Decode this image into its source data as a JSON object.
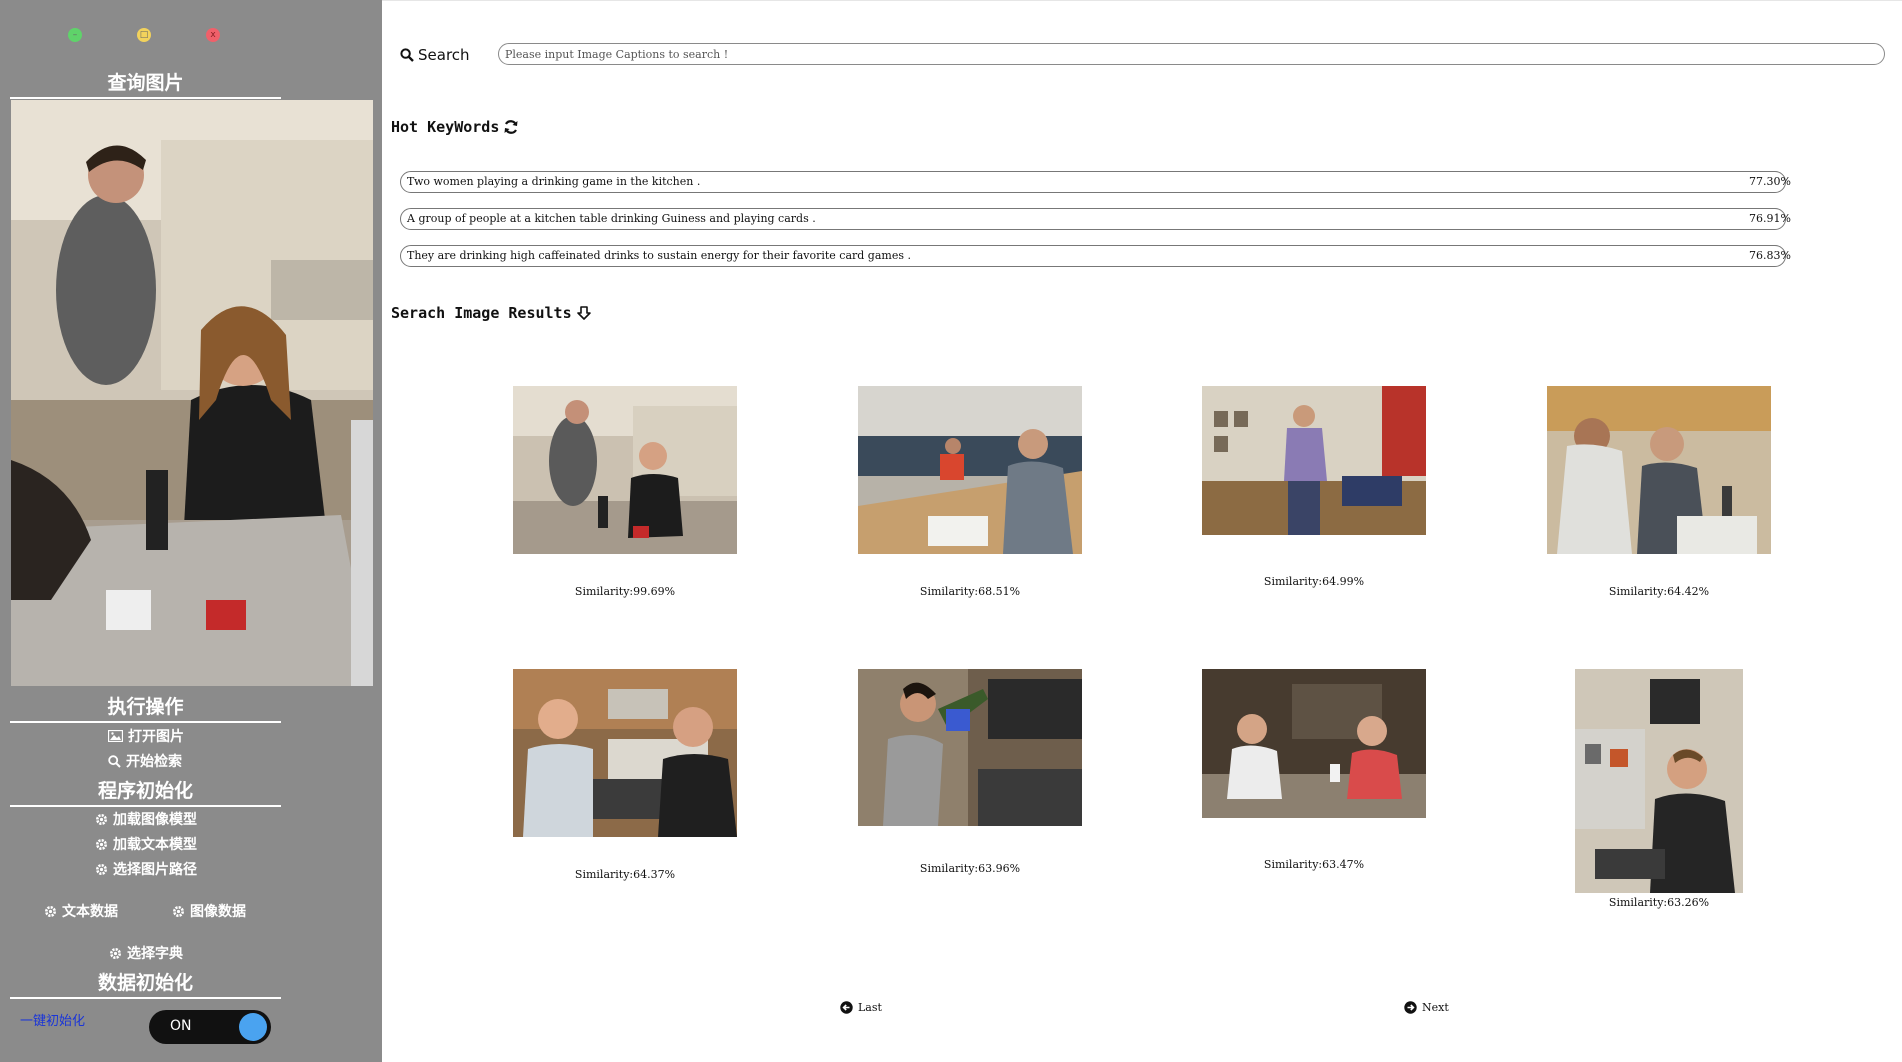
{
  "window_controls": {
    "minimize": "–",
    "maximize": "□",
    "close": "x"
  },
  "sidebar": {
    "query_title": "查询图片",
    "ops_title": "执行操作",
    "open_image": "打开图片",
    "start_search": "开始检索",
    "init_title": "程序初始化",
    "load_image_model": "加载图像模型",
    "load_text_model": "加载文本模型",
    "select_image_path": "选择图片路径",
    "text_data": "文本数据",
    "image_data": "图像数据",
    "select_dictionary": "选择字典",
    "data_init_title": "数据初始化",
    "one_key_init": "一键初始化",
    "toggle_label": "ON",
    "toggle_state": "on"
  },
  "search": {
    "label": "Search",
    "placeholder": "Please input Image Captions to search !",
    "value": ""
  },
  "hot_keywords": {
    "title": "Hot KeyWords",
    "items": [
      {
        "text": "Two women playing a drinking game in the kitchen .",
        "score": "77.30%"
      },
      {
        "text": "A group of people at a kitchen table drinking Guiness and playing cards .",
        "score": "76.91%"
      },
      {
        "text": "They are drinking high caffeinated drinks to sustain energy for their favorite card games .",
        "score": "76.83%"
      }
    ]
  },
  "results": {
    "title": "Serach Image Results",
    "items": [
      {
        "caption": "Similarity:99.69%"
      },
      {
        "caption": "Similarity:68.51%"
      },
      {
        "caption": "Similarity:64.99%"
      },
      {
        "caption": "Similarity:64.42%"
      },
      {
        "caption": "Similarity:64.37%"
      },
      {
        "caption": "Similarity:63.96%"
      },
      {
        "caption": "Similarity:63.47%"
      },
      {
        "caption": "Similarity:63.26%"
      }
    ]
  },
  "pager": {
    "last": "Last",
    "next": "Next"
  },
  "colors": {
    "sidebar_bg": "#8b8b8b",
    "toggle_knob": "#4aa3f0",
    "link": "#1a35d8"
  }
}
